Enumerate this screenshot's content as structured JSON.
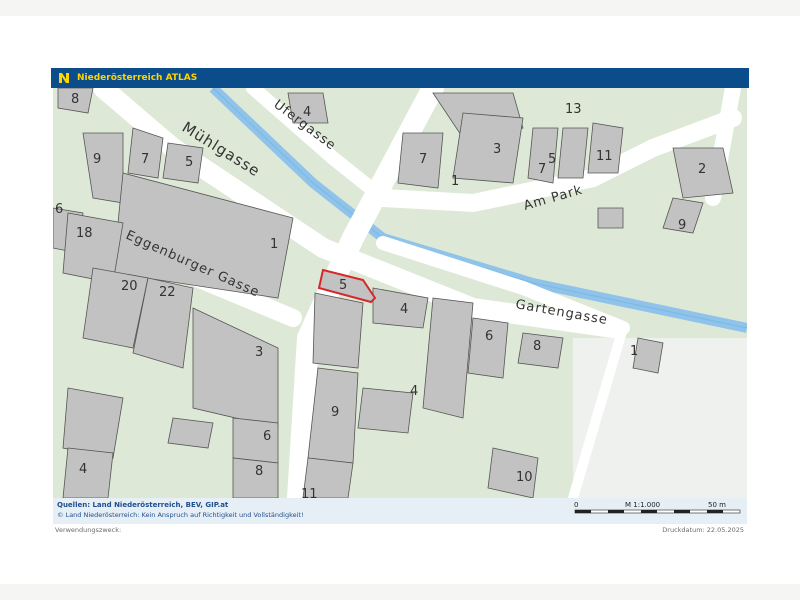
{
  "header": {
    "title": "Niederösterreich ATLAS",
    "logo_icon": "noe-logo-icon"
  },
  "map": {
    "streets": [
      "Mühlgasse",
      "Ufergasse",
      "Am Park",
      "Eggenburger Gasse",
      "Gartengasse"
    ],
    "house_numbers": [
      "8",
      "4",
      "13",
      "9",
      "7",
      "5",
      "7",
      "3",
      "5",
      "7",
      "11",
      "1",
      "2",
      "6",
      "18",
      "1",
      "9",
      "20",
      "22",
      "5",
      "4",
      "6",
      "8",
      "1",
      "3",
      "9",
      "4",
      "6",
      "4",
      "8",
      "10",
      "11"
    ],
    "colors": {
      "building": "#c2c2c2",
      "road": "#ffffff",
      "river": "#8fc3ea",
      "vegetation": "#dde9d6",
      "highlight": "#d62828"
    }
  },
  "footer": {
    "sources": "Quellen: Land Niederösterreich, BEV, GIP.at",
    "copyright": "© Land Niederösterreich: Kein Anspruch auf Richtigkeit und Vollständigkeit!",
    "scale_start": "0",
    "scale_ratio": "M 1:1.000",
    "scale_end": "50 m"
  },
  "meta": {
    "purpose": "Verwendungszweck:",
    "print_date": "Druckdatum: 22.05.2025"
  }
}
